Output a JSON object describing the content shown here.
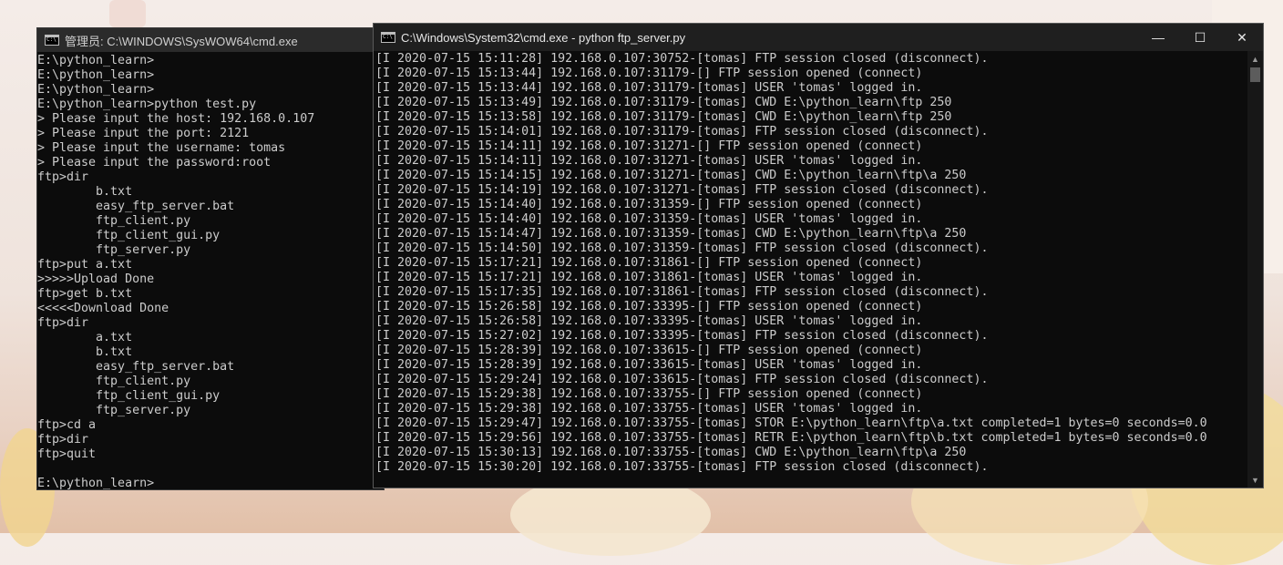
{
  "window_left": {
    "title": "管理员: C:\\WINDOWS\\SysWOW64\\cmd.exe",
    "lines": [
      "E:\\python_learn>",
      "E:\\python_learn>",
      "E:\\python_learn>",
      "E:\\python_learn>python test.py",
      "> Please input the host: 192.168.0.107",
      "> Please input the port: 2121",
      "> Please input the username: tomas",
      "> Please input the password:root",
      "ftp>dir",
      "        b.txt",
      "        easy_ftp_server.bat",
      "        ftp_client.py",
      "        ftp_client_gui.py",
      "        ftp_server.py",
      "ftp>put a.txt",
      ">>>>>Upload Done",
      "ftp>get b.txt",
      "<<<<<Download Done",
      "ftp>dir",
      "        a.txt",
      "        b.txt",
      "        easy_ftp_server.bat",
      "        ftp_client.py",
      "        ftp_client_gui.py",
      "        ftp_server.py",
      "ftp>cd a",
      "ftp>dir",
      "ftp>quit",
      "",
      "E:\\python_learn>"
    ]
  },
  "window_right": {
    "title": "C:\\Windows\\System32\\cmd.exe - python  ftp_server.py",
    "controls": {
      "minimize": "—",
      "maximize": "☐",
      "close": "✕"
    },
    "lines": [
      "[I 2020-07-15 15:11:28] 192.168.0.107:30752-[tomas] FTP session closed (disconnect).",
      "[I 2020-07-15 15:13:44] 192.168.0.107:31179-[] FTP session opened (connect)",
      "[I 2020-07-15 15:13:44] 192.168.0.107:31179-[tomas] USER 'tomas' logged in.",
      "[I 2020-07-15 15:13:49] 192.168.0.107:31179-[tomas] CWD E:\\python_learn\\ftp 250",
      "[I 2020-07-15 15:13:58] 192.168.0.107:31179-[tomas] CWD E:\\python_learn\\ftp 250",
      "[I 2020-07-15 15:14:01] 192.168.0.107:31179-[tomas] FTP session closed (disconnect).",
      "[I 2020-07-15 15:14:11] 192.168.0.107:31271-[] FTP session opened (connect)",
      "[I 2020-07-15 15:14:11] 192.168.0.107:31271-[tomas] USER 'tomas' logged in.",
      "[I 2020-07-15 15:14:15] 192.168.0.107:31271-[tomas] CWD E:\\python_learn\\ftp\\a 250",
      "[I 2020-07-15 15:14:19] 192.168.0.107:31271-[tomas] FTP session closed (disconnect).",
      "[I 2020-07-15 15:14:40] 192.168.0.107:31359-[] FTP session opened (connect)",
      "[I 2020-07-15 15:14:40] 192.168.0.107:31359-[tomas] USER 'tomas' logged in.",
      "[I 2020-07-15 15:14:47] 192.168.0.107:31359-[tomas] CWD E:\\python_learn\\ftp\\a 250",
      "[I 2020-07-15 15:14:50] 192.168.0.107:31359-[tomas] FTP session closed (disconnect).",
      "[I 2020-07-15 15:17:21] 192.168.0.107:31861-[] FTP session opened (connect)",
      "[I 2020-07-15 15:17:21] 192.168.0.107:31861-[tomas] USER 'tomas' logged in.",
      "[I 2020-07-15 15:17:35] 192.168.0.107:31861-[tomas] FTP session closed (disconnect).",
      "[I 2020-07-15 15:26:58] 192.168.0.107:33395-[] FTP session opened (connect)",
      "[I 2020-07-15 15:26:58] 192.168.0.107:33395-[tomas] USER 'tomas' logged in.",
      "[I 2020-07-15 15:27:02] 192.168.0.107:33395-[tomas] FTP session closed (disconnect).",
      "[I 2020-07-15 15:28:39] 192.168.0.107:33615-[] FTP session opened (connect)",
      "[I 2020-07-15 15:28:39] 192.168.0.107:33615-[tomas] USER 'tomas' logged in.",
      "[I 2020-07-15 15:29:24] 192.168.0.107:33615-[tomas] FTP session closed (disconnect).",
      "[I 2020-07-15 15:29:38] 192.168.0.107:33755-[] FTP session opened (connect)",
      "[I 2020-07-15 15:29:38] 192.168.0.107:33755-[tomas] USER 'tomas' logged in.",
      "[I 2020-07-15 15:29:47] 192.168.0.107:33755-[tomas] STOR E:\\python_learn\\ftp\\a.txt completed=1 bytes=0 seconds=0.0",
      "[I 2020-07-15 15:29:56] 192.168.0.107:33755-[tomas] RETR E:\\python_learn\\ftp\\b.txt completed=1 bytes=0 seconds=0.0",
      "[I 2020-07-15 15:30:13] 192.168.0.107:33755-[tomas] CWD E:\\python_learn\\ftp\\a 250",
      "[I 2020-07-15 15:30:20] 192.168.0.107:33755-[tomas] FTP session closed (disconnect)."
    ]
  }
}
